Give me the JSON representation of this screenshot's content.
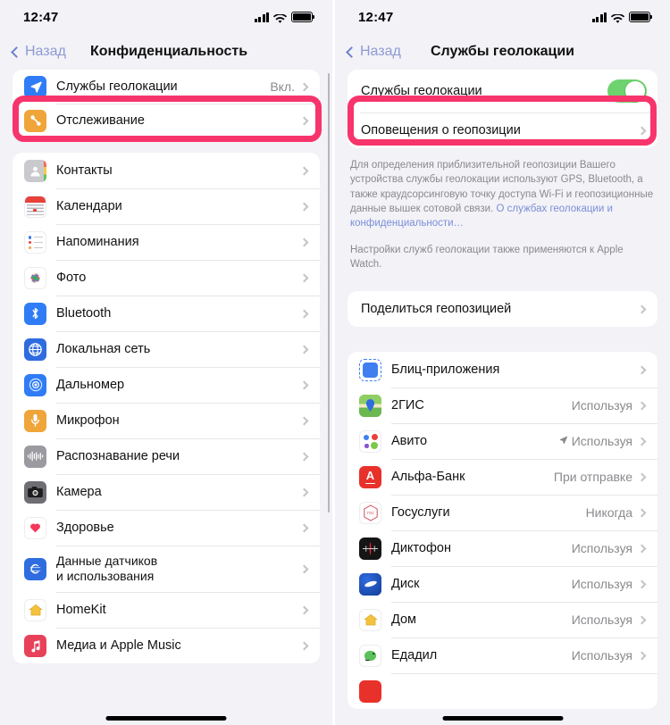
{
  "status": {
    "time": "12:47",
    "signal_icon": "cellular-bars-icon",
    "wifi_icon": "wifi-icon",
    "battery_icon": "battery-full-icon"
  },
  "highlight_color": "#f7346b",
  "left_screen": {
    "back_label": "Назад",
    "title": "Конфиденциальность",
    "top_group": [
      {
        "icon": "location-services-icon",
        "label": "Службы геолокации",
        "value": "Вкл."
      },
      {
        "icon": "tracking-icon",
        "label": "Отслеживание",
        "value": ""
      }
    ],
    "apps_group": [
      {
        "icon": "contacts-icon",
        "label": "Контакты"
      },
      {
        "icon": "calendar-icon",
        "label": "Календари"
      },
      {
        "icon": "reminders-icon",
        "label": "Напоминания"
      },
      {
        "icon": "photos-icon",
        "label": "Фото"
      },
      {
        "icon": "bluetooth-icon",
        "label": "Bluetooth"
      },
      {
        "icon": "local-network-icon",
        "label": "Локальная сеть"
      },
      {
        "icon": "measure-icon",
        "label": "Дальномер"
      },
      {
        "icon": "microphone-icon",
        "label": "Микрофон"
      },
      {
        "icon": "speech-recognition-icon",
        "label": "Распознавание речи"
      },
      {
        "icon": "camera-icon",
        "label": "Камера"
      },
      {
        "icon": "health-icon",
        "label": "Здоровье"
      },
      {
        "icon": "sensor-data-icon",
        "label": "Данные датчиков\nи использования"
      },
      {
        "icon": "homekit-icon",
        "label": "HomeKit"
      },
      {
        "icon": "apple-music-icon",
        "label": "Медиа и Apple Music"
      }
    ]
  },
  "right_screen": {
    "back_label": "Назад",
    "title": "Службы геолокации",
    "toggle_row": {
      "label": "Службы геолокации",
      "state": "on"
    },
    "alerts_row": {
      "label": "Оповещения о геопозиции"
    },
    "description_1_part1": "Для определения приблизительной геопозиции Вашего устройства службы геолокации используют GPS, Bluetooth, а также краудсорсинговую точку доступа Wi-Fi и геопозиционные данные вышек сотовой связи. ",
    "description_1_link": "О службах геолокации и конфиденциальности…",
    "description_2": "Настройки служб геолокации также применяются к Apple Watch.",
    "share_row": {
      "label": "Поделиться геопозицией"
    },
    "apps": [
      {
        "icon": "blitz-apps-icon",
        "label": "Блиц-приложения",
        "value": "",
        "arrow": false
      },
      {
        "icon": "2gis-icon",
        "label": "2ГИС",
        "value": "Используя",
        "arrow": false
      },
      {
        "icon": "avito-icon",
        "label": "Авито",
        "value": "Используя",
        "arrow": true
      },
      {
        "icon": "alfa-bank-icon",
        "label": "Альфа-Банк",
        "value": "При отправке",
        "arrow": false
      },
      {
        "icon": "gosuslugi-icon",
        "label": "Госуслуги",
        "value": "Никогда",
        "arrow": false
      },
      {
        "icon": "voice-memos-icon",
        "label": "Диктофон",
        "value": "Используя",
        "arrow": false
      },
      {
        "icon": "yandex-disk-icon",
        "label": "Диск",
        "value": "Используя",
        "arrow": false
      },
      {
        "icon": "home-app-icon",
        "label": "Дом",
        "value": "Используя",
        "arrow": false
      },
      {
        "icon": "edadil-icon",
        "label": "Едадил",
        "value": "Используя",
        "arrow": false
      }
    ]
  }
}
